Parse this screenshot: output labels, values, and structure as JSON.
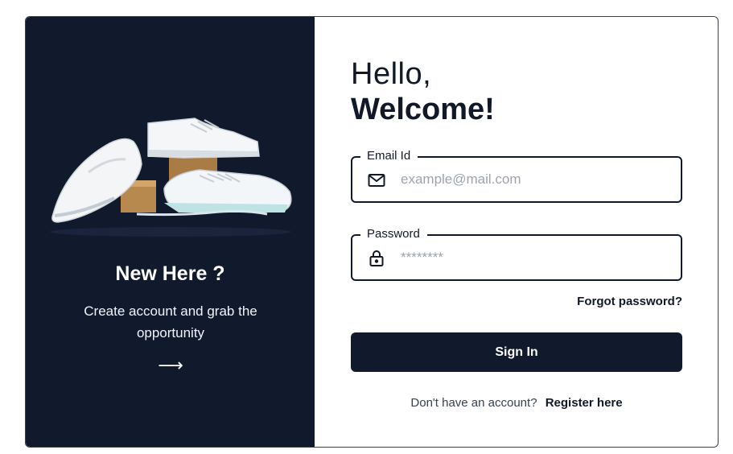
{
  "promo": {
    "title": "New Here ?",
    "subtitle": "Create account and grab the opportunity",
    "arrow": "⟶"
  },
  "login": {
    "greeting": "Hello,",
    "welcome": "Welcome!",
    "email": {
      "label": "Email Id",
      "placeholder": "example@mail.com",
      "value": ""
    },
    "password": {
      "label": "Password",
      "placeholder": "********",
      "value": ""
    },
    "forgot": "Forgot password?",
    "submit": "Sign In",
    "register_prompt": "Don't have an account?",
    "register_link": "Register here"
  },
  "icons": {
    "email": "mail-icon",
    "password": "lock-icon",
    "promo_arrow": "arrow-right-icon"
  },
  "colors": {
    "panel": "#111a2d",
    "button": "#111a2d",
    "text": "#111827",
    "placeholder": "#9ca3af"
  }
}
